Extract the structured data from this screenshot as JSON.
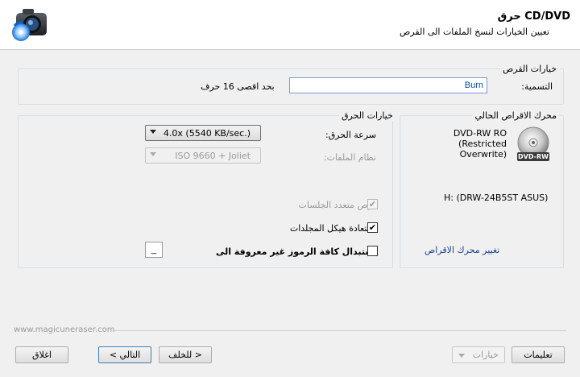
{
  "header": {
    "title": "CD/DVD حرق",
    "subtitle": "تعيين الخيارات لنسخ الملفات الى القرص",
    "logo_icon": "camera-disc-logo-icon"
  },
  "disc_options": {
    "group_title": "خيارات القرص",
    "label_text": "التسمية:",
    "label_value": "Burn",
    "max_hint": "بحد اقصى 16 حرف"
  },
  "burn_options": {
    "group_title": "خيارات الحرق",
    "speed_label": "سرعة الحرق:",
    "speed_value": "4.0x (5540 KB/sec.)",
    "fs_label": "نظام الملفات:",
    "fs_value": "ISO 9660 + Joliet",
    "multisession_label": "قرص متعدد الجلسات",
    "multisession_checked": true,
    "restore_folders_label": "استعادة هيكل المجلدات",
    "restore_folders_checked": true,
    "replace_chars_label": "استبدال كافة الرموز غير معروفة الى",
    "replace_chars_checked": false,
    "replace_char_value": "_"
  },
  "drive": {
    "group_title": "محرك الاقراص الحالي",
    "media_type": "DVD-RW RO (Restricted Overwrite)",
    "drive_name": "H: (DRW-24B5ST ASUS)",
    "change_link": "تغيير محرك الاقراص",
    "disc_badge": "DVD-RW"
  },
  "footer": {
    "website": "www.magicuneraser.com",
    "help_button": "تعليمات",
    "options_button": "خيارات",
    "back_button": "< للخلف",
    "next_button": "التالي >",
    "close_button": "اغلاق"
  }
}
